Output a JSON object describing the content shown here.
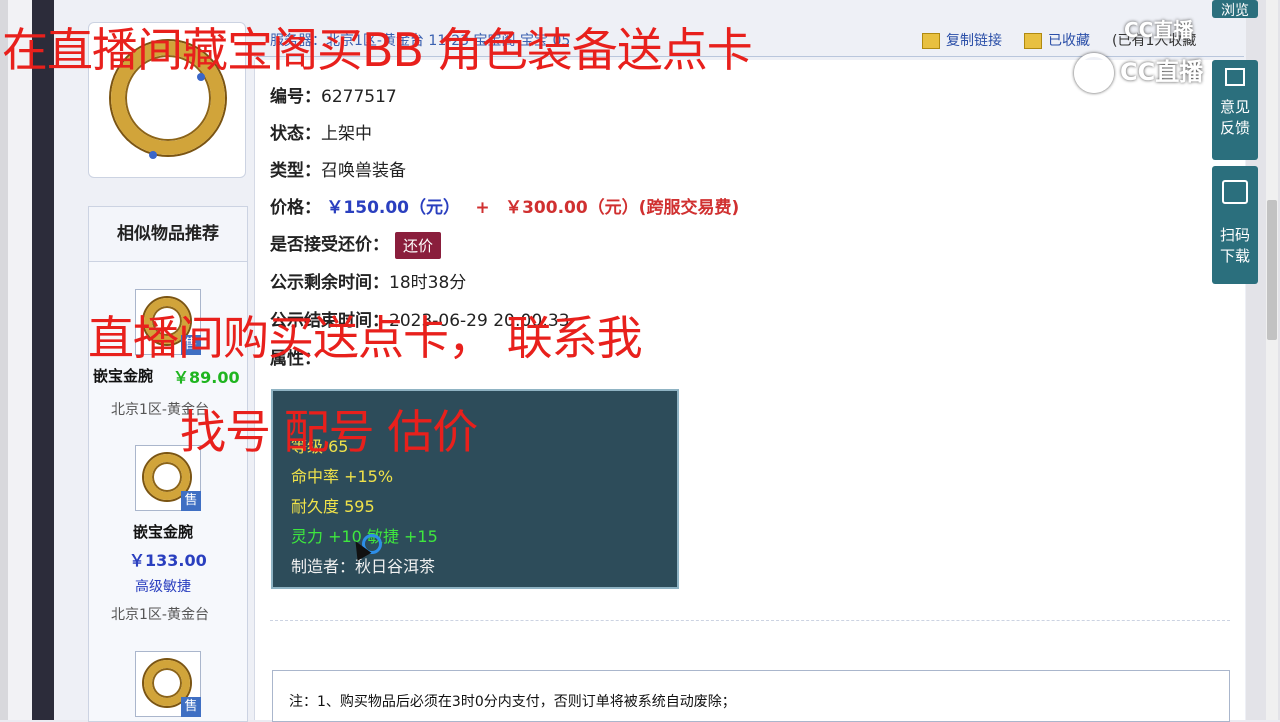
{
  "topbar": {
    "server_text": "服务器：北京1区-黄金台    11-23 宝宝阁   宝宝 05",
    "copy_link": "复制链接",
    "collected": "已收藏",
    "fav_count": "(已有1人收藏"
  },
  "item": {
    "id_label": "编号：",
    "id_value": "6277517",
    "status_label": "状态：",
    "status_value": "上架中",
    "type_label": "类型：",
    "type_value": "召唤兽装备",
    "price_label": "价格：",
    "price_main": "￥150.00（元）",
    "price_plus": "+",
    "price_fee": "￥300.00（元）(跨服交易费)",
    "counter_label": "是否接受还价：",
    "counter_button": "还价",
    "remaining_label": "公示剩余时间：",
    "remaining_value": "18时38分",
    "end_label": "公示结束时间：",
    "end_value": "2023-06-29 20:00:33",
    "attr_label": "属性："
  },
  "attributes": {
    "level": "等级 65",
    "hit": "命中率 +15%",
    "durability": "耐久度 595",
    "stats": "灵力 +10 敏捷 +15",
    "maker": "制造者：秋日谷洱茶"
  },
  "recommend": {
    "title": "相似物品推荐",
    "sale_tag": "售",
    "items": [
      {
        "name": "嵌宝金腕",
        "price": "￥89.00",
        "server": "北京1区-黄金台"
      },
      {
        "name": "嵌宝金腕",
        "price": "￥133.00",
        "desc": "高级敏捷",
        "server": "北京1区-黄金台"
      }
    ]
  },
  "note": {
    "text": "注：1、购买物品后必须在3时0分内支付，否则订单将被系统自动废除；"
  },
  "side": {
    "browse": "浏览",
    "feedback_1": "意见",
    "feedback_2": "反馈",
    "scan_1": "扫码",
    "scan_2": "下载"
  },
  "overlay": {
    "line1": "在直播间藏宝阁买BB 角色装备送点卡",
    "line2": "直播间购买送点卡，  联系我",
    "line3": "找号 配号 估价"
  },
  "watermark": {
    "top": "CC直播",
    "second": "CC直播"
  },
  "colors": {
    "accent_red": "#e8201c",
    "price_blue": "#2a3fbf",
    "attr_bg": "#2d4c5a",
    "sidebar_teal": "#2b6f7d"
  }
}
